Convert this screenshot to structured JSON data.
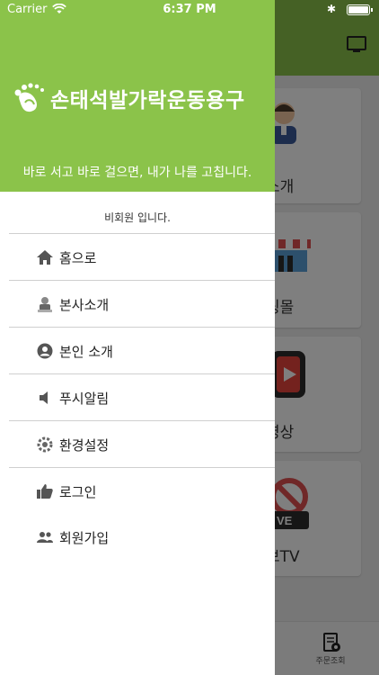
{
  "status_bar": {
    "carrier": "Carrier",
    "time": "6:37 PM",
    "bluetooth": "✱"
  },
  "drawer": {
    "brand_name": "손태석발가락운동용구",
    "tagline": "바로 서고 바로 걸으면, 내가 나를 고칩니다.",
    "member_status": "비회원 입니다.",
    "menu": [
      {
        "label": "홈으로",
        "icon": "home-icon"
      },
      {
        "label": "본사소개",
        "icon": "company-icon"
      },
      {
        "label": "본인 소개",
        "icon": "account-icon"
      },
      {
        "label": "푸시알림",
        "icon": "speaker-icon"
      },
      {
        "label": "환경설정",
        "icon": "settings-icon"
      },
      {
        "label": "로그인",
        "icon": "thumbs-up-icon"
      },
      {
        "label": "회원가입",
        "icon": "group-icon"
      }
    ]
  },
  "background": {
    "tiles": [
      {
        "label": "소개"
      },
      {
        "label": "핑몰"
      },
      {
        "label": "영상"
      },
      {
        "label": "브TV"
      }
    ],
    "bottom_nav": {
      "order_label": "주문조회"
    }
  },
  "colors": {
    "brand_green": "#8bc34a",
    "overlay": "rgba(0,0,0,0.5)"
  }
}
